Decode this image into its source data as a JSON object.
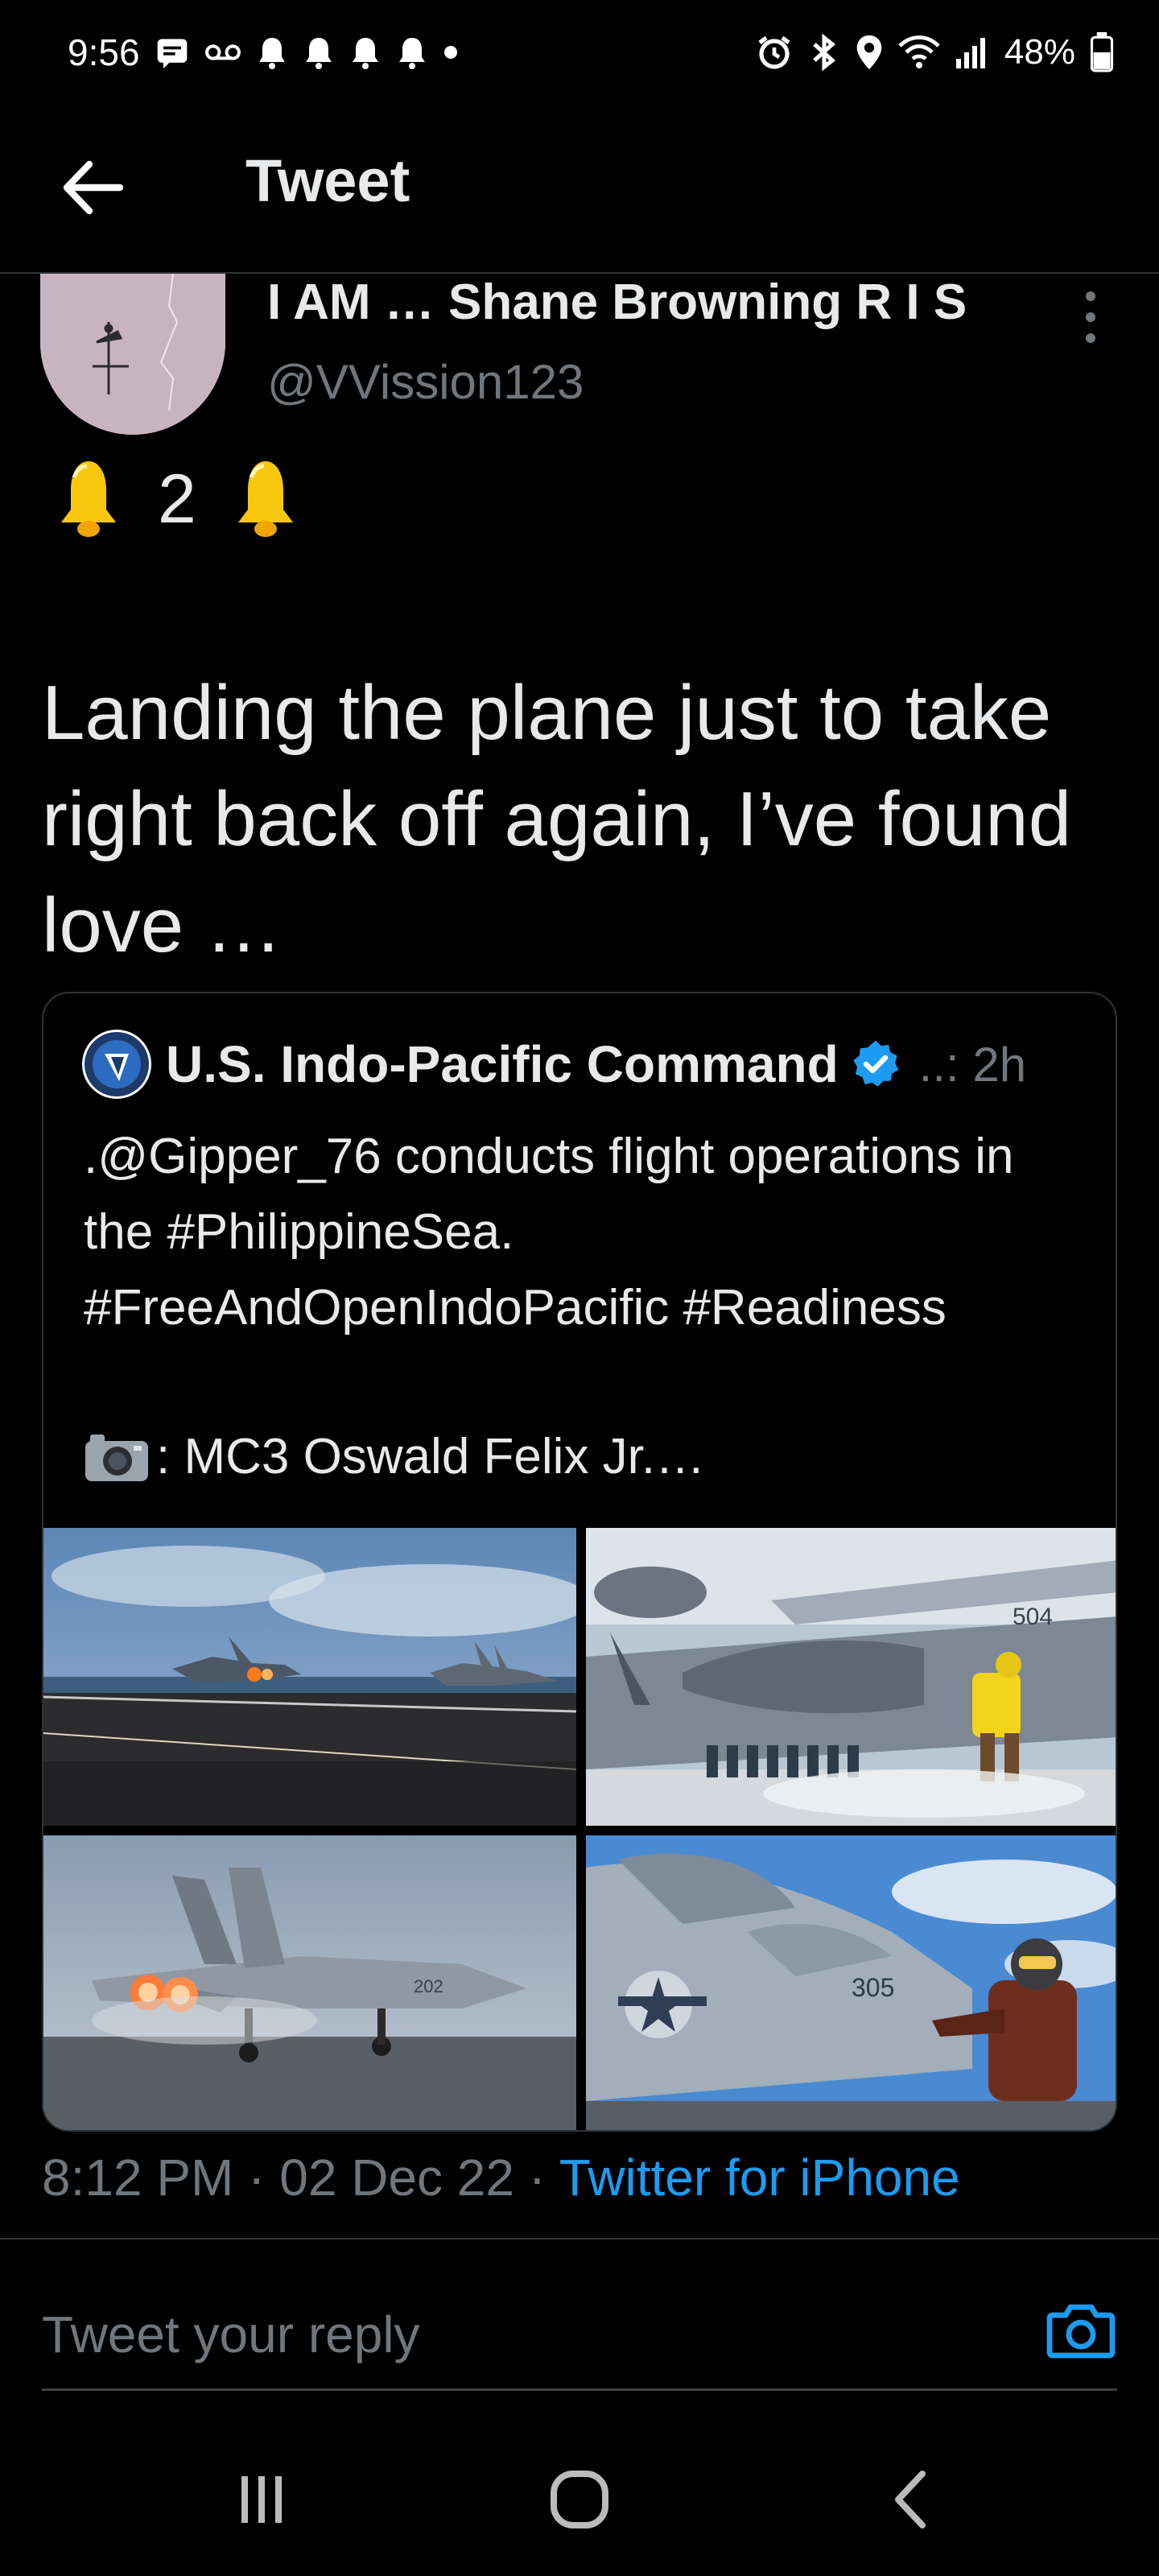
{
  "status_bar": {
    "time": "9:56",
    "battery": "48%"
  },
  "header": {
    "title": "Tweet"
  },
  "tweet": {
    "author_name": "I AM … Shane Browning R I S",
    "author_handle": "@VVission123",
    "emoji_count": "2",
    "text": "Landing the plane just to take right back off again, I’ve found love …",
    "timestamp": "8:12 PM · 02 Dec 22 · ",
    "source": "Twitter for iPhone"
  },
  "quote": {
    "name": "U.S. Indo-Pacific Command",
    "time": "..: 2h",
    "text": ".@Gipper_76 conducts flight operations in the #PhilippineSea. #FreeAndOpenIndoPacific #Readiness",
    "credit": ": MC3 Oswald Felix Jr.…",
    "photo_labels": [
      "504",
      "202",
      "305"
    ]
  },
  "reply": {
    "placeholder": "Tweet your reply"
  },
  "colors": {
    "accent": "#1d9bf0",
    "text_primary": "#e7e9ea",
    "text_secondary": "#71767b",
    "border": "#2f3336"
  },
  "icons": {
    "back": "arrow-left-icon",
    "more": "more-vertical-icon",
    "verified": "verified-badge-icon",
    "camera": "camera-icon",
    "recents": "recents-icon",
    "home": "home-icon",
    "nav_back": "chevron-left-icon"
  }
}
